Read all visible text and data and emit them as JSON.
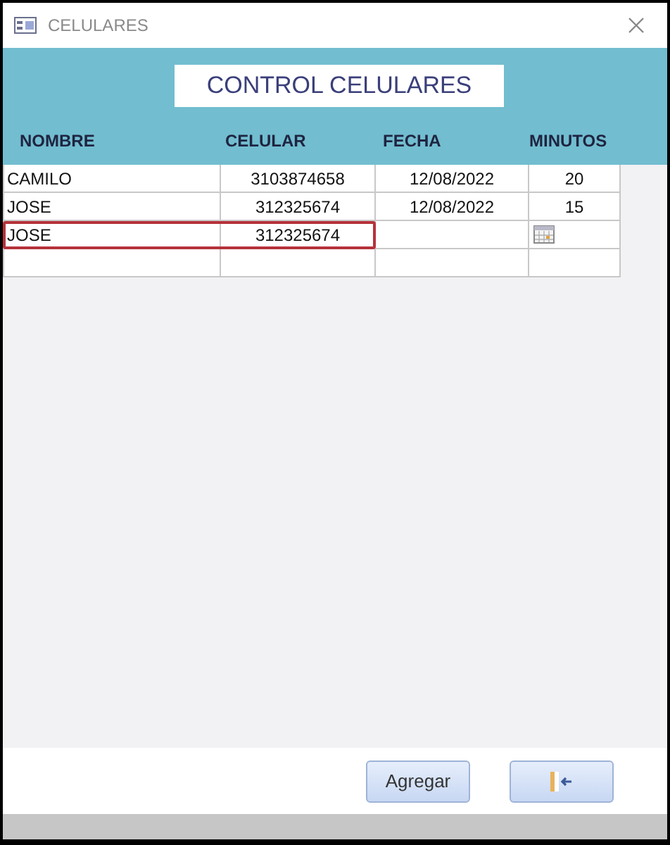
{
  "window": {
    "title": "CELULARES"
  },
  "header": {
    "title": "CONTROL CELULARES"
  },
  "table": {
    "columns": [
      "NOMBRE",
      "CELULAR",
      "FECHA",
      "MINUTOS"
    ],
    "rows": [
      {
        "nombre": "CAMILO",
        "celular": "3103874658",
        "fecha": "12/08/2022",
        "minutos": "20",
        "selected": false,
        "date_picker": false
      },
      {
        "nombre": "JOSE",
        "celular": "312325674",
        "fecha": "12/08/2022",
        "minutos": "15",
        "selected": false,
        "date_picker": false
      },
      {
        "nombre": "JOSE",
        "celular": "312325674",
        "selected": true,
        "date_picker": true
      },
      {
        "selected": false,
        "date_picker": false
      }
    ]
  },
  "buttons": [
    {
      "kind": "text",
      "label": "Agregar"
    },
    {
      "kind": "exit"
    }
  ]
}
